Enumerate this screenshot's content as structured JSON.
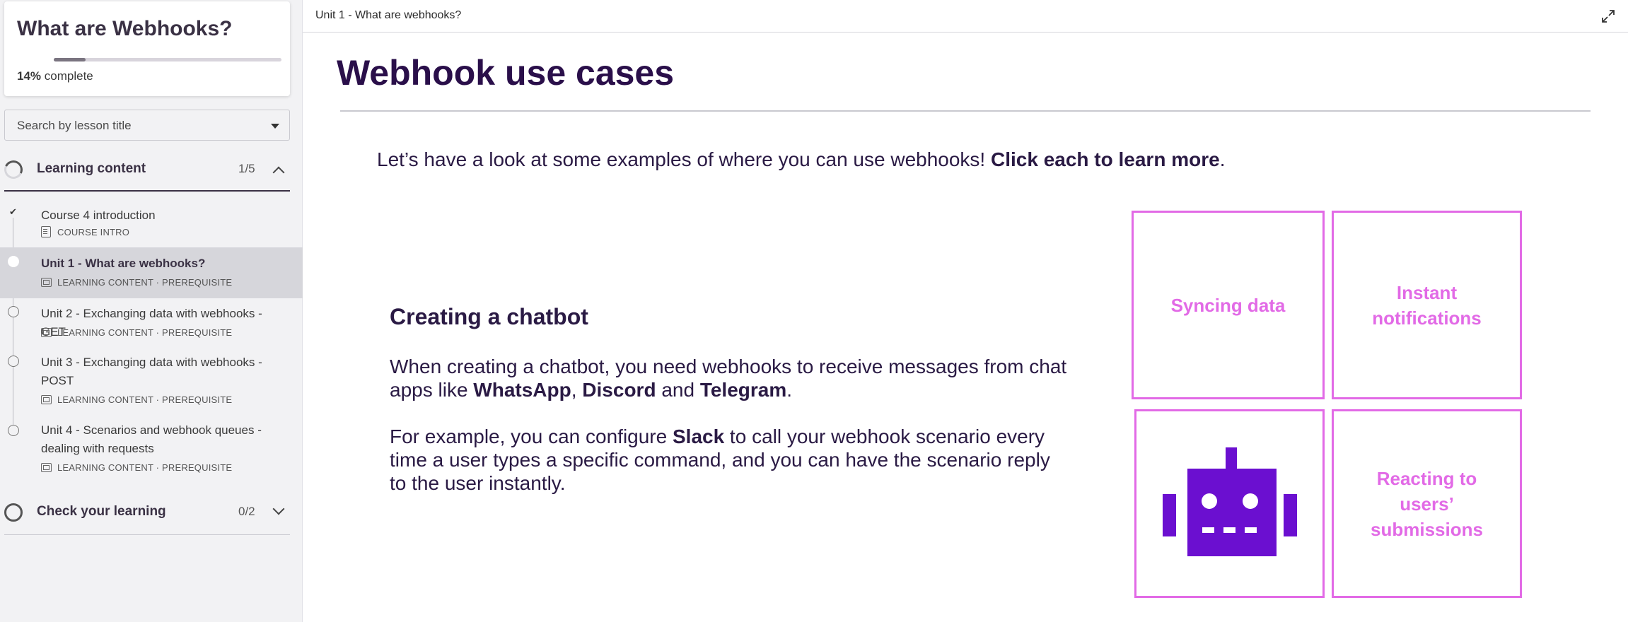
{
  "course": {
    "title": "What are Webhooks?",
    "progress_percent": "14%",
    "progress_fraction": 0.14,
    "progress_suffix": "complete"
  },
  "search": {
    "placeholder": "Search by lesson title"
  },
  "sections": [
    {
      "label": "Learning content",
      "count": "1/5",
      "expanded": true
    },
    {
      "label": "Check your learning",
      "count": "0/2",
      "expanded": false
    }
  ],
  "lessons": [
    {
      "title": "Course 4 introduction",
      "meta": "COURSE INTRO",
      "status": "done",
      "icon": "book-icon"
    },
    {
      "title": "Unit 1 - What are webhooks?",
      "meta": "LEARNING CONTENT · PREREQUISITE",
      "status": "current",
      "icon": "doc-icon"
    },
    {
      "title": "Unit 2 - Exchanging data with webhooks - GET",
      "meta": "LEARNING CONTENT · PREREQUISITE",
      "status": "todo",
      "icon": "doc-icon"
    },
    {
      "title": "Unit 3 - Exchanging data with webhooks - POST",
      "meta": "LEARNING CONTENT · PREREQUISITE",
      "status": "todo",
      "icon": "doc-icon"
    },
    {
      "title": "Unit 4 - Scenarios and webhook queues - dealing with requests",
      "meta": "LEARNING CONTENT · PREREQUISITE",
      "status": "todo",
      "icon": "doc-icon"
    }
  ],
  "main": {
    "breadcrumb": "Unit 1 - What are webhooks?",
    "page_title": "Webhook use cases",
    "intro_text": "Let’s have a look at some examples of where you can use webhooks! ",
    "intro_bold": "Click each to learn more",
    "intro_end": ".",
    "detail": {
      "title": "Creating a chatbot",
      "p1_a": "When creating a chatbot, you need webhooks to receive messages from chat apps like ",
      "p1_b1": "WhatsApp",
      "p1_sep1": ", ",
      "p1_b2": "Discord",
      "p1_sep2": " and ",
      "p1_b3": "Telegram",
      "p1_end": ".",
      "p2_a": "For example, you can configure ",
      "p2_b": "Slack",
      "p2_c": " to call your webhook scenario every time a user types a specific command, and you can have the scenario reply to the user instantly."
    },
    "tiles": [
      {
        "label": "Syncing data"
      },
      {
        "label": "Instant notifications"
      },
      {
        "label": "",
        "icon": "robot-icon"
      },
      {
        "label": "Reacting to users’ submissions"
      }
    ]
  },
  "colors": {
    "accent_pink": "#e26ae6",
    "robot_purple": "#6b0fd0",
    "title_purple": "#2a0f4a"
  }
}
